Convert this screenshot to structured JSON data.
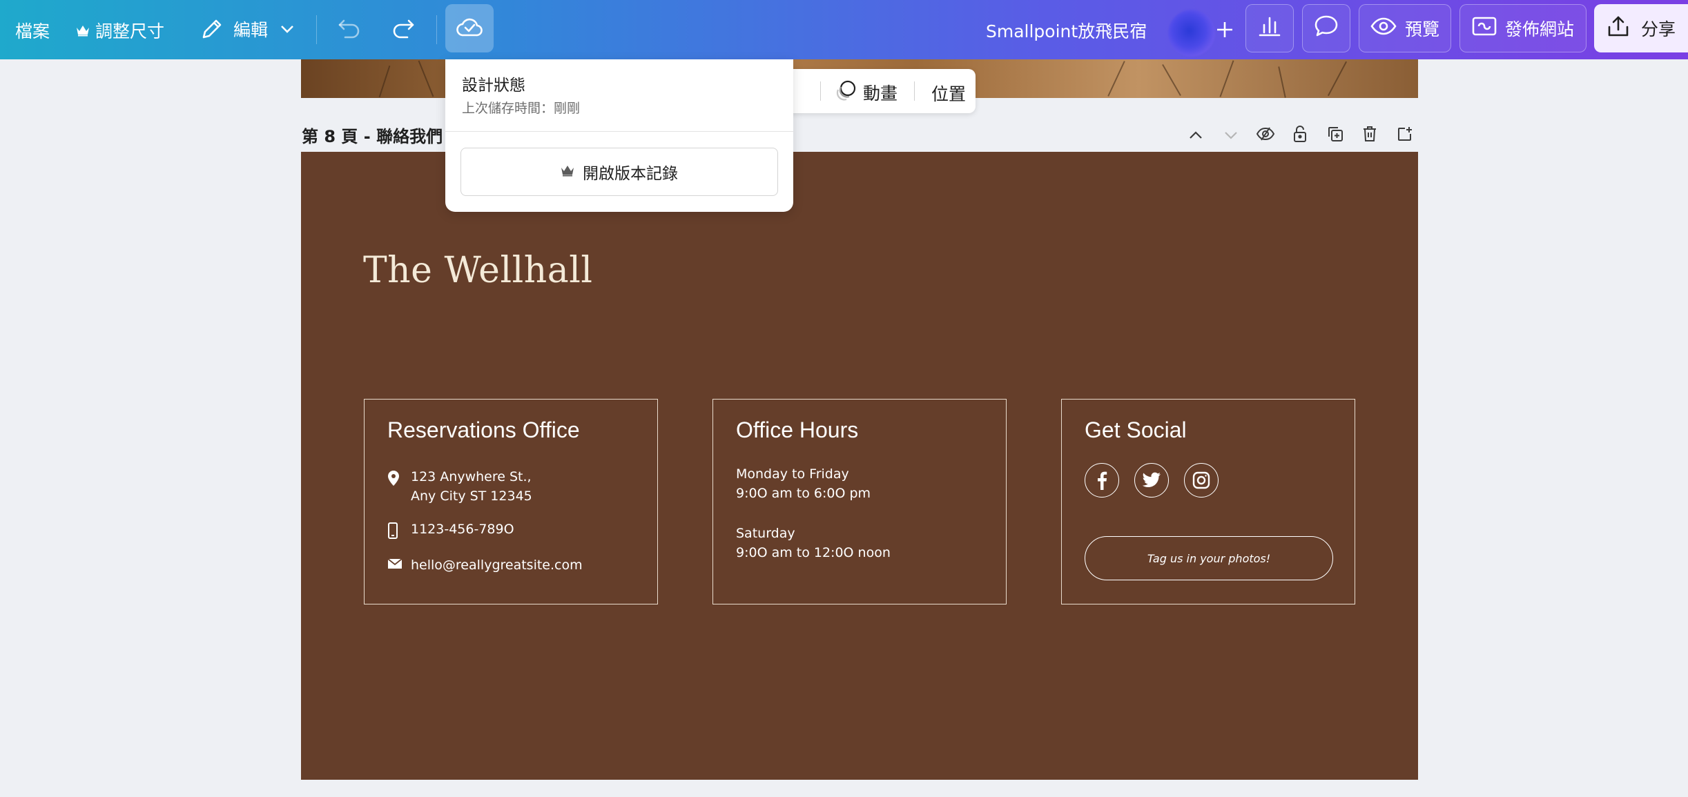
{
  "toolbar": {
    "file_label": "檔案",
    "resize_label": "調整尺寸",
    "edit_label": "編輯",
    "project_title": "Smallpoint放飛民宿",
    "preview_label": "預覽",
    "publish_label": "發佈網站",
    "share_label": "分享"
  },
  "floating_toolbar": {
    "animate_label": "動畫",
    "position_label": "位置"
  },
  "page_header": {
    "label": "第 8 頁 - 聯絡我們"
  },
  "design": {
    "brand_name": "The Wellhall",
    "reservations": {
      "title": "Reservations Office",
      "address_line1": "123 Anywhere St.,",
      "address_line2": "Any City ST 12345",
      "phone": "1123-456-789O",
      "email": "hello@reallygreatsite.com"
    },
    "hours": {
      "title": "Office Hours",
      "weekday_label": "Monday to Friday",
      "weekday_time": "9:0O am to 6:0O pm",
      "saturday_label": "Saturday",
      "saturday_time": "9:0O am to 12:0O noon"
    },
    "social": {
      "title": "Get Social",
      "icons": [
        "facebook-icon",
        "twitter-icon",
        "instagram-icon"
      ],
      "tag_button": "Tag us in your photos!"
    }
  },
  "popover": {
    "title": "設計狀態",
    "last_saved": "上次儲存時間：剛剛",
    "version_history_button": "開啟版本記錄"
  },
  "colors": {
    "page_background": "#653e2a",
    "brand_text": "#f4ead8",
    "topbar_gradient_start": "#1fa9cc",
    "topbar_gradient_end": "#7a3fe4"
  }
}
